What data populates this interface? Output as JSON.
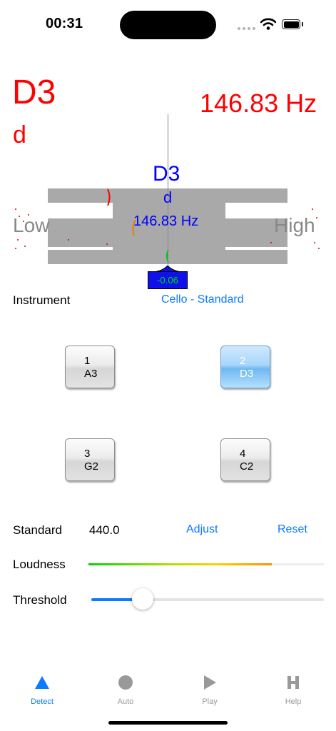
{
  "status": {
    "time": "00:31"
  },
  "reading": {
    "note": "D3",
    "solfege": "d",
    "frequency": "146.83 Hz"
  },
  "tuner": {
    "note": "D3",
    "solfege": "d",
    "frequency": "146.83 Hz",
    "low_label": "Low",
    "high_label": "High",
    "cents": "-0.06"
  },
  "instrument": {
    "label": "Instrument",
    "value": "Cello - Standard"
  },
  "strings": [
    {
      "number": "1",
      "note": "A3",
      "selected": false
    },
    {
      "number": "2",
      "note": "D3",
      "selected": true
    },
    {
      "number": "3",
      "note": "G2",
      "selected": false
    },
    {
      "number": "4",
      "note": "C2",
      "selected": false
    }
  ],
  "standard": {
    "label": "Standard",
    "value": "440.0",
    "adjust": "Adjust",
    "reset": "Reset"
  },
  "loudness": {
    "label": "Loudness",
    "level": 0.78
  },
  "threshold": {
    "label": "Threshold",
    "level": 0.22
  },
  "colors": {
    "accent": "#0a7aff",
    "reading": "#ff0000",
    "tuner_text": "#0000ff",
    "cents_bg": "#1010e8",
    "cents_text": "#00e000"
  },
  "tabs": [
    {
      "label": "Detect",
      "icon": "triangle-icon",
      "active": true
    },
    {
      "label": "Auto",
      "icon": "circle-icon",
      "active": false
    },
    {
      "label": "Play",
      "icon": "play-icon",
      "active": false
    },
    {
      "label": "Help",
      "icon": "help-h-icon",
      "active": false
    }
  ]
}
